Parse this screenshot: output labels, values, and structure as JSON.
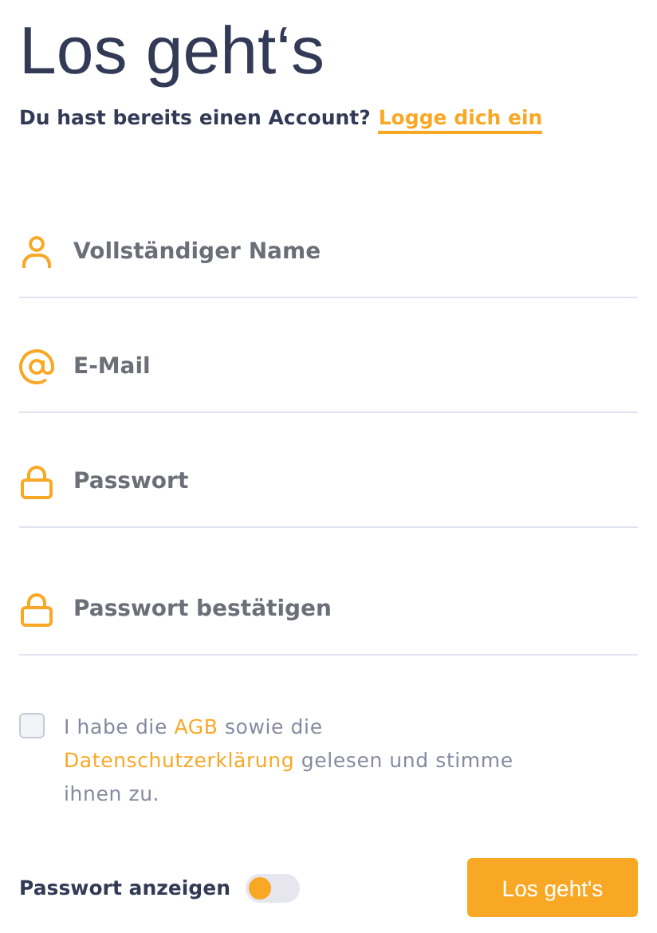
{
  "title": "Los geht‘s",
  "login_prompt": {
    "text": "Du hast bereits einen Account?",
    "link": "Logge dich ein"
  },
  "fields": [
    {
      "kind": "name",
      "placeholder": "Vollständiger Name"
    },
    {
      "kind": "email",
      "placeholder": "E-Mail"
    },
    {
      "kind": "password",
      "placeholder": "Passwort"
    },
    {
      "kind": "password",
      "placeholder": "Passwort bestätigen"
    }
  ],
  "terms": {
    "checked": false,
    "parts": [
      {
        "kind": "text",
        "text": "I habe die "
      },
      {
        "kind": "link",
        "text": "AGB"
      },
      {
        "kind": "text",
        "text": " sowie die "
      },
      {
        "kind": "link",
        "text": "Datenschutzerklärung"
      },
      {
        "kind": "text",
        "text": " gelesen und stimme ihnen zu."
      }
    ]
  },
  "show_password": {
    "label": "Passwort anzeigen",
    "on": false
  },
  "submit": "Los geht's"
}
